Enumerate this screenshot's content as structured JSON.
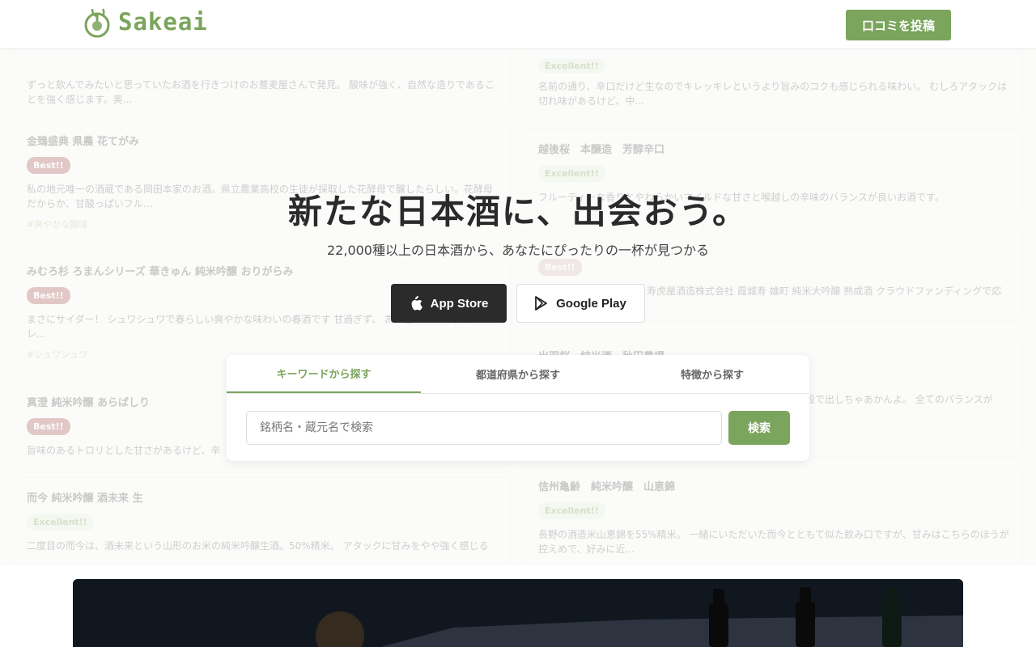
{
  "header": {
    "logo_text": "Sakeai",
    "post_button": "口コミを投稿"
  },
  "hero": {
    "title": "新たな日本酒に、出会おう。",
    "subtitle": "22,000種以上の日本酒から、あなたにぴったりの一杯が見つかる",
    "app_store": "App Store",
    "google_play": "Google Play"
  },
  "search": {
    "tabs": [
      "キーワードから探す",
      "都道府県から探す",
      "特徴から探す"
    ],
    "placeholder": "銘柄名・蔵元名で検索",
    "button": "検索"
  },
  "reviews_left": [
    {
      "title": "",
      "badge": "",
      "desc": "ずっと飲んでみたいと思っていたお酒を行きつけのお蕎麦屋さんで発見。 酸味が強く、自然な造りであることを強く感じます。奥...",
      "tag": ""
    },
    {
      "title": "金鵄盛典 県農 花てがみ",
      "badge": "Best!!",
      "desc": "私の地元唯一の酒蔵である岡田本家のお酒。県立農業高校の生徒が採取した花酵母で醸したらしい。花酵母だからか、甘酸っぱいフル...",
      "tag": "#爽やかな酸味"
    },
    {
      "title": "みむろ杉 ろまんシリーズ 華きゅん 純米吟醸 おりがらみ",
      "badge": "Best!!",
      "desc": "まさにサイダー！ シュワシュワで春らしい爽やかな味わいの春酒です 甘過ぎず、 為、旨味やコクよりフレ...",
      "tag": "#シュワシュワ"
    },
    {
      "title": "真澄 純米吟醸 あらばしり",
      "badge": "Best!!",
      "desc": "旨味のあるトロリとした甘さがあるけど、辛",
      "tag": ""
    },
    {
      "title": "而今 純米吟醸 酒未来 生",
      "badge": "Excellent!!",
      "desc": "二度目の而今は、酒未来という山形のお米の純米吟醸生酒。50%精米。 アタックに甘みをやや強く感じる",
      "tag": ""
    }
  ],
  "reviews_right": [
    {
      "title": "",
      "badge": "Excellent!!",
      "desc": "名前の通り、辛口だけど生なのでキレッキレというより旨みのコクも感じられる味わい。 むしろアタックは切れ味があるけど、中...",
      "tag": ""
    },
    {
      "title": "越後桜　本醸造　芳醇辛口",
      "badge": "Excellent!!",
      "desc": "フルーティーな香りとやわらかいマイルドな甘さと喉越しの辛味のバランスが良いお酒です。",
      "tag": ""
    },
    {
      "title": "",
      "badge": "Best!!",
      "desc": "寿虎屋酒造株式会社 霞城寿 雄町 純米大吟醸 熟成酒 クラウドファンディングで応",
      "tag": ""
    },
    {
      "title": "出羽桜　純米酒　秋田農場",
      "badge": "",
      "desc": "段で出しちゃあかんよ。 全てのバランスが",
      "tag": ""
    },
    {
      "title": "信州亀齢　純米吟醸　山恵錦",
      "badge": "Excellent!!",
      "desc": "長野の酒造米山恵錦を55%精米。 一緒にいただいた而今とともて似た飲み口ですが、甘みはこちらのほうが控えめで、好みに近...",
      "tag": ""
    }
  ],
  "colors": {
    "brand_green": "#7ba45c",
    "best_badge": "#a5534f"
  }
}
